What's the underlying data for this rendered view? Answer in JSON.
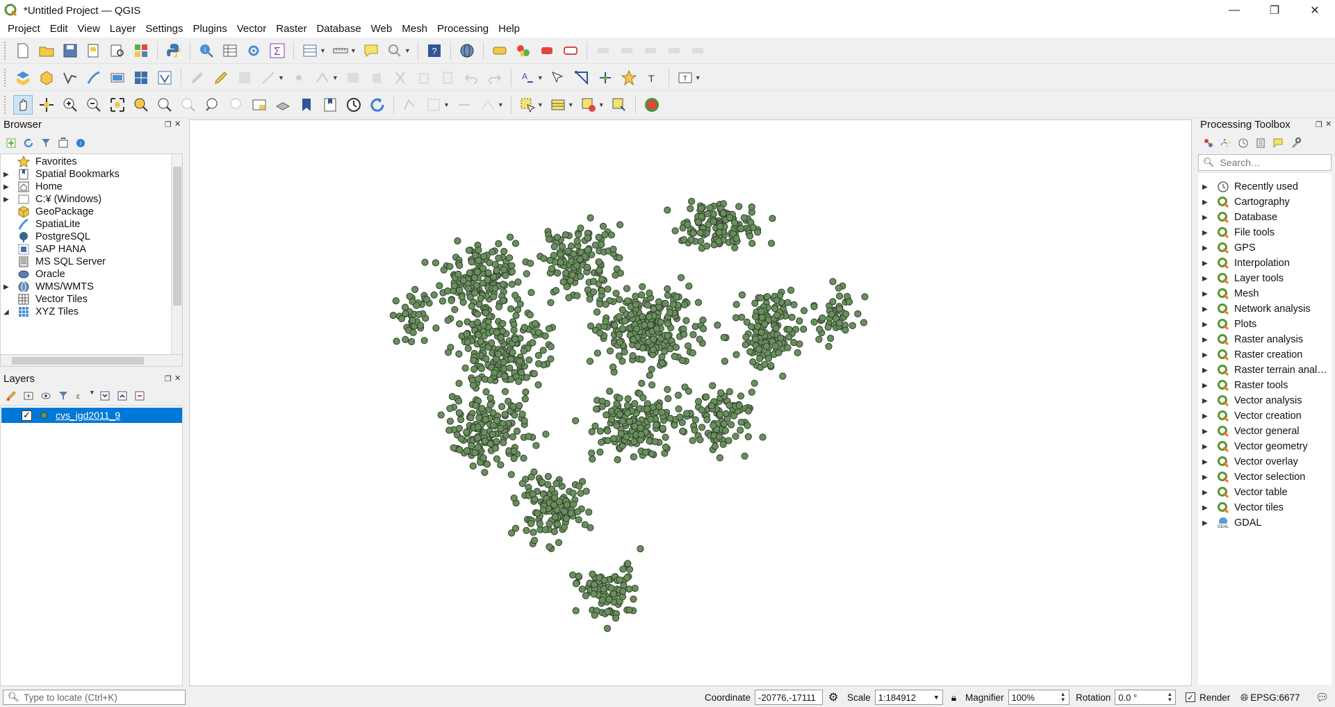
{
  "window": {
    "title": "*Untitled Project — QGIS",
    "controls": [
      "minimize",
      "restore",
      "close"
    ]
  },
  "menubar": {
    "items": [
      "Project",
      "Edit",
      "View",
      "Layer",
      "Settings",
      "Plugins",
      "Vector",
      "Raster",
      "Database",
      "Web",
      "Mesh",
      "Processing",
      "Help"
    ]
  },
  "browser": {
    "title": "Browser",
    "items": [
      {
        "label": "Favorites",
        "icon": "star-icon"
      },
      {
        "label": "Spatial Bookmarks",
        "icon": "bookmark-icon"
      },
      {
        "label": "Home",
        "icon": "home-icon"
      },
      {
        "label": "C:¥ (Windows)",
        "icon": "drive-icon"
      },
      {
        "label": "GeoPackage",
        "icon": "geopackage-icon"
      },
      {
        "label": "SpatiaLite",
        "icon": "spatialite-icon"
      },
      {
        "label": "PostgreSQL",
        "icon": "postgresql-icon"
      },
      {
        "label": "SAP HANA",
        "icon": "sap-hana-icon"
      },
      {
        "label": "MS SQL Server",
        "icon": "mssql-icon"
      },
      {
        "label": "Oracle",
        "icon": "oracle-icon"
      },
      {
        "label": "WMS/WMTS",
        "icon": "globe-icon"
      },
      {
        "label": "Vector Tiles",
        "icon": "vector-tiles-icon"
      },
      {
        "label": "XYZ Tiles",
        "icon": "xyz-tiles-icon"
      }
    ]
  },
  "layers": {
    "title": "Layers",
    "items": [
      {
        "name": "cvs_jgd2011_9",
        "visible": true,
        "selected": true,
        "symbol_color": "#6a8f5e"
      }
    ]
  },
  "processing": {
    "title": "Processing Toolbox",
    "search_placeholder": "Search…",
    "groups": [
      "Recently used",
      "Cartography",
      "Database",
      "File tools",
      "GPS",
      "Interpolation",
      "Layer tools",
      "Mesh",
      "Network analysis",
      "Plots",
      "Raster analysis",
      "Raster creation",
      "Raster terrain anal…",
      "Raster tools",
      "Vector analysis",
      "Vector creation",
      "Vector general",
      "Vector geometry",
      "Vector overlay",
      "Vector selection",
      "Vector table",
      "Vector tiles",
      "GDAL"
    ]
  },
  "statusbar": {
    "locator_placeholder": "Type to locate (Ctrl+K)",
    "coordinate_label": "Coordinate",
    "coordinate_value": "-20776,-17111",
    "scale_label": "Scale",
    "scale_value": "1:184912",
    "magnifier_label": "Magnifier",
    "magnifier_value": "100%",
    "rotation_label": "Rotation",
    "rotation_value": "0.0 °",
    "render_label": "Render",
    "render_checked": true,
    "crs": "EPSG:6677"
  },
  "colors": {
    "point_fill": "#6a8f5e",
    "point_stroke": "#2f3f2a",
    "selection": "#0078d7"
  }
}
